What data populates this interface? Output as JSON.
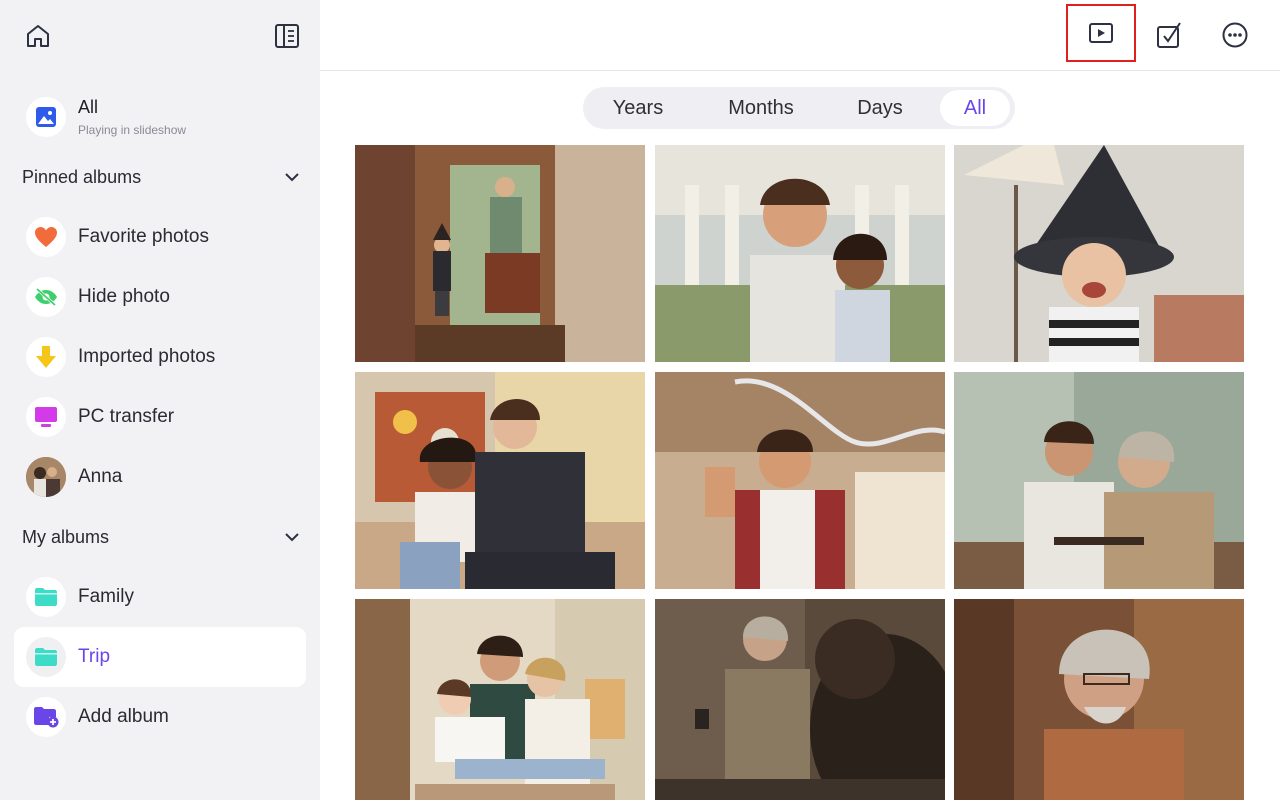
{
  "sidebar": {
    "all": {
      "title": "All",
      "subtitle": "Playing in slideshow"
    },
    "pinned_header": "Pinned albums",
    "pinned": [
      {
        "label": "Favorite photos",
        "icon": "heart-icon",
        "color": "#f26b3a"
      },
      {
        "label": "Hide photo",
        "icon": "eye-off-icon",
        "color": "#3ccf6a"
      },
      {
        "label": "Imported photos",
        "icon": "download-arrow-icon",
        "color": "#f5c518"
      },
      {
        "label": "PC transfer",
        "icon": "monitor-icon",
        "color": "#d43be8"
      },
      {
        "label": "Anna",
        "icon": "avatar"
      }
    ],
    "albums_header": "My albums",
    "albums": [
      {
        "label": "Family",
        "icon": "folder-icon",
        "color": "#3ddcc6"
      },
      {
        "label": "Trip",
        "icon": "folder-icon",
        "color": "#3ddcc6",
        "active": true
      },
      {
        "label": "Add album",
        "icon": "folder-add-icon",
        "color": "#6a45e8"
      }
    ]
  },
  "toolbar": {
    "slideshow": "play-slideshow-icon",
    "select": "select-check-icon",
    "more": "more-icon"
  },
  "tabs": [
    {
      "label": "Years"
    },
    {
      "label": "Months"
    },
    {
      "label": "Days"
    },
    {
      "label": "All",
      "active": true
    }
  ],
  "colors": {
    "accent": "#6a45e8",
    "highlight_box": "#e01f1f",
    "sidebar_bg": "#f2f2f5"
  },
  "photos": [
    {
      "subject": "child in witch costume in hallway with man"
    },
    {
      "subject": "couple selfie in front of building"
    },
    {
      "subject": "child in witch hat laughing"
    },
    {
      "subject": "couple sitting on floor"
    },
    {
      "subject": "young man giving thumbs up"
    },
    {
      "subject": "young man and older man at table"
    },
    {
      "subject": "family with child on sofa"
    },
    {
      "subject": "older man in dim room"
    },
    {
      "subject": "older man with glasses close-up"
    }
  ]
}
